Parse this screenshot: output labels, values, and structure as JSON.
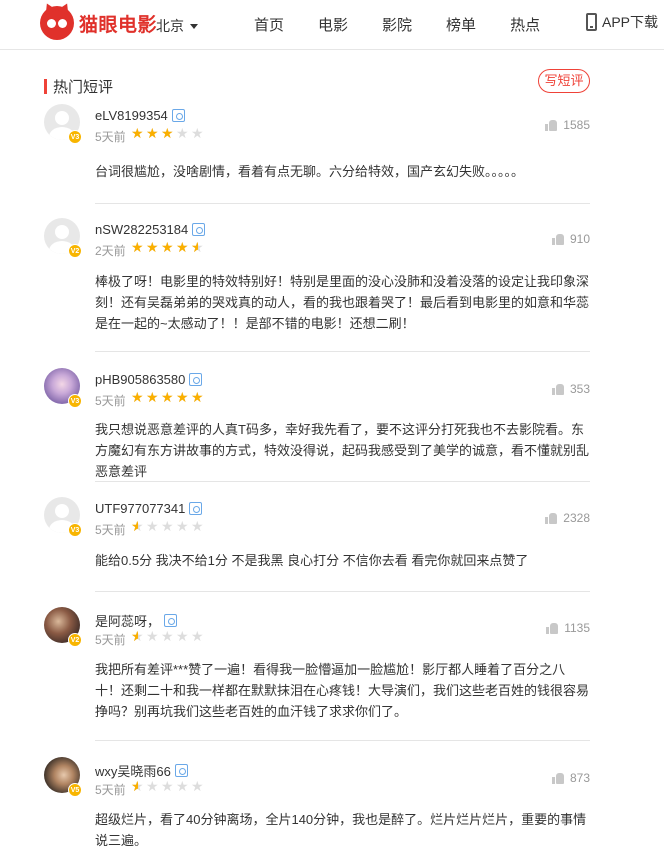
{
  "header": {
    "logo_text": "猫眼电影",
    "city": "北京",
    "nav": [
      "首页",
      "电影",
      "影院",
      "榜单",
      "热点"
    ],
    "app_download": "APP下载"
  },
  "section": {
    "title": "热门短评",
    "write_button": "写短评"
  },
  "comments": [
    {
      "username": "eLV8199354",
      "level": "V3",
      "time": "5天前",
      "rating_stars": 3,
      "likes": "1585",
      "content": "台词很尴尬，没啥剧情，看着有点无聊。六分给特效，国产玄幻失败。。。。。"
    },
    {
      "username": "nSW282253184",
      "level": "V2",
      "time": "2天前",
      "rating_stars": 4.5,
      "likes": "910",
      "content": "棒极了呀！电影里的特效特别好！特别是里面的没心没肺和没着没落的设定让我印象深刻！还有吴磊弟弟的哭戏真的动人，看的我也跟着哭了！最后看到电影里的如意和华蕊是在一起的~太感动了！！是部不错的电影！还想二刷！"
    },
    {
      "username": "pHB905863580",
      "level": "V3",
      "time": "5天前",
      "rating_stars": 5,
      "likes": "353",
      "content": "我只想说恶意差评的人真T码多，幸好我先看了，要不这评分打死我也不去影院看。东方魔幻有东方讲故事的方式，特效没得说，起码我感受到了美学的诚意，看不懂就别乱恶意差评"
    },
    {
      "username": "UTF977077341",
      "level": "V3",
      "time": "5天前",
      "rating_stars": 0.5,
      "likes": "2328",
      "content": "能给0.5分 我决不给1分 不是我黑 良心打分 不信你去看 看完你就回来点赞了"
    },
    {
      "username": "是阿蕊呀，",
      "level": "V2",
      "time": "5天前",
      "rating_stars": 0.5,
      "likes": "1135",
      "content": "我把所有差评***赞了一遍！看得我一脸懵逼加一脸尴尬！影厅都人睡着了百分之八十！还剩二十和我一样都在默默抹泪在心疼钱！大导演们，我们这些老百姓的钱很容易挣吗？别再坑我们这些老百姓的血汗钱了求求你们了。"
    },
    {
      "username": "wxy吴晓雨66",
      "level": "V5",
      "time": "5天前",
      "rating_stars": 0.5,
      "likes": "873",
      "content": "超级烂片，看了40分钟离场，全片140分钟，我也是醉了。烂片烂片烂片，重要的事情说三遍。"
    }
  ]
}
